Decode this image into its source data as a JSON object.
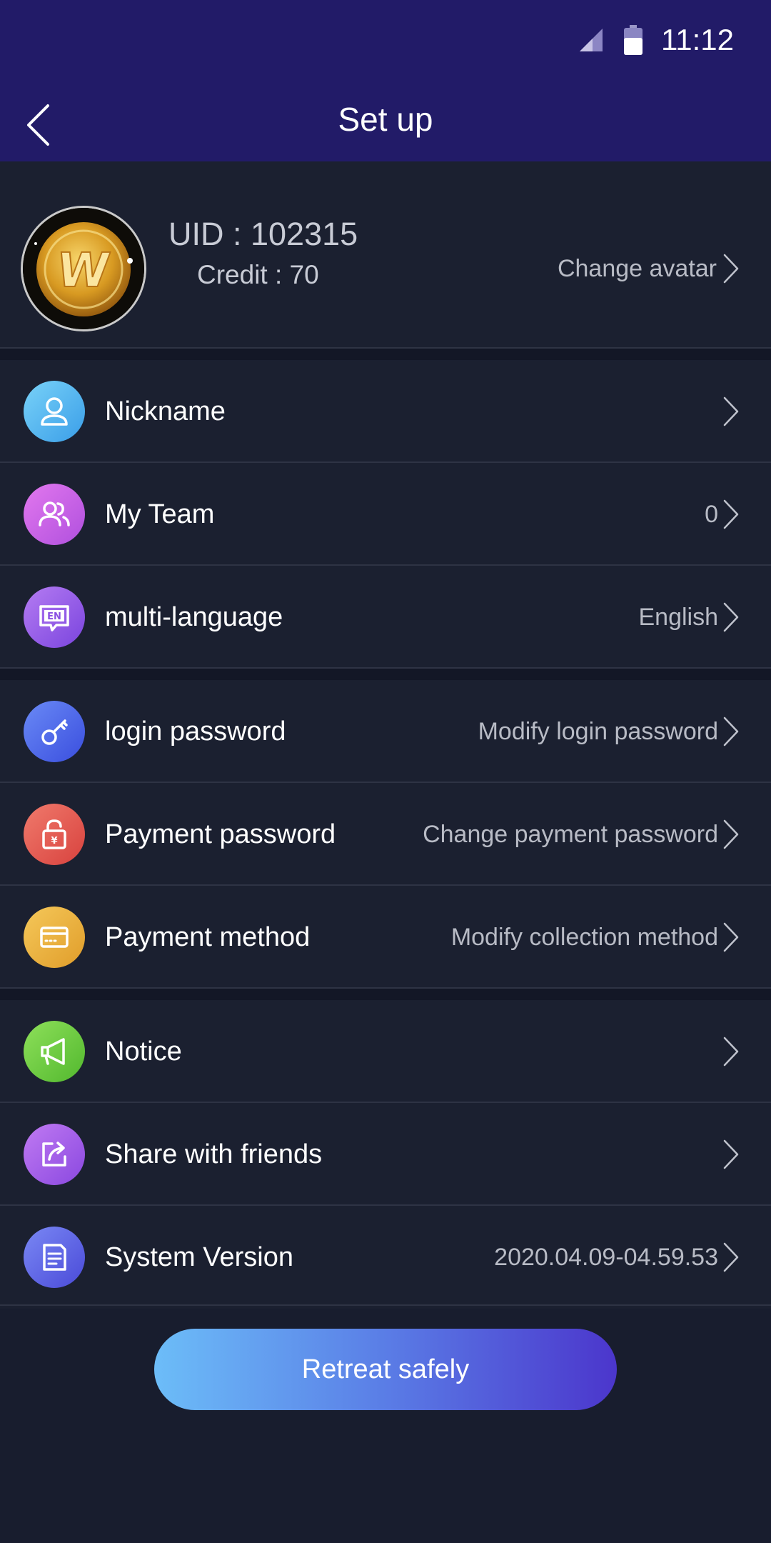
{
  "status_bar": {
    "time": "11:12",
    "signal_icon": "cell-signal-icon",
    "battery_icon": "battery-icon"
  },
  "header": {
    "title": "Set up",
    "back_icon": "chevron-left-icon"
  },
  "profile": {
    "uid": "UID : 102315",
    "credit": "Credit : 70",
    "change_avatar": "Change avatar",
    "avatar_letter": "W"
  },
  "rows": [
    {
      "label": "Nickname",
      "value": "",
      "icon": "user-icon",
      "color": "#4fb4f0"
    },
    {
      "label": "My Team",
      "value": "0",
      "icon": "team-icon",
      "color": "#c060e0"
    },
    {
      "label": "multi-language",
      "value": "English",
      "icon": "language-icon",
      "color": "#9a55e6"
    },
    {
      "label": "login password",
      "value": "Modify login password",
      "icon": "key-icon",
      "color": "#4c6cea"
    },
    {
      "label": "Payment password",
      "value": "Change payment password",
      "icon": "lock-icon",
      "color": "#e35a56"
    },
    {
      "label": "Payment method",
      "value": "Modify collection method",
      "icon": "card-icon",
      "color": "#eab13f"
    },
    {
      "label": "Notice",
      "value": "",
      "icon": "megaphone-icon",
      "color": "#6cc83e"
    },
    {
      "label": "Share with friends",
      "value": "",
      "icon": "share-icon",
      "color": "#9f55e8"
    },
    {
      "label": "System Version",
      "value": "2020.04.09-04.59.53",
      "icon": "document-icon",
      "color": "#5b68e4"
    }
  ],
  "retreat_button": "Retreat safely"
}
